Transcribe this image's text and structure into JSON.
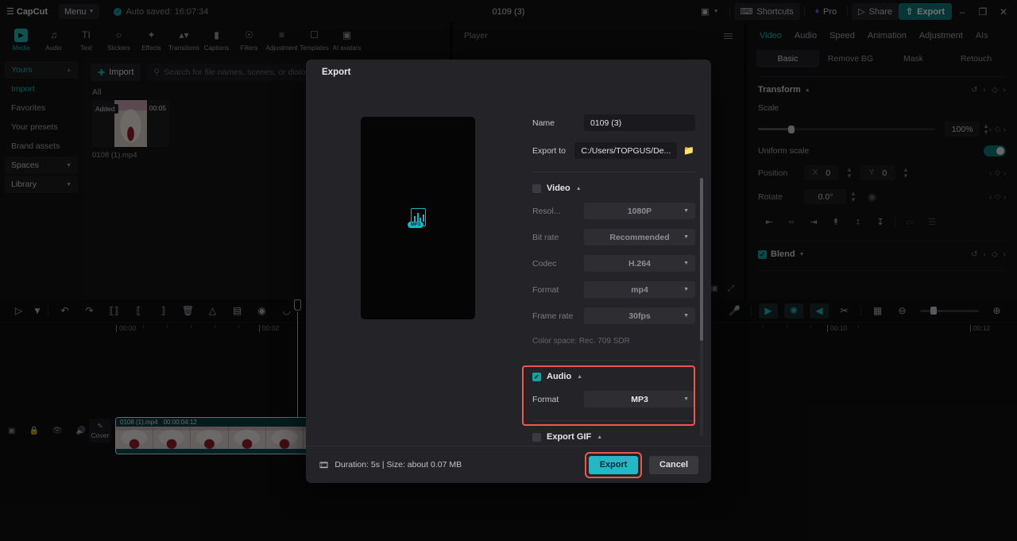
{
  "topbar": {
    "logo_text": "CapCut",
    "menu_label": "Menu",
    "autosave_text": "Auto saved: 16:07:34",
    "project_title": "0109 (3)",
    "layout_icon": "layout-icon",
    "shortcuts_label": "Shortcuts",
    "pro_label": "Pro",
    "share_label": "Share",
    "export_label": "Export",
    "minimize_label": "–",
    "maximize_label": "❐",
    "close_label": "✕"
  },
  "tooltabs": [
    {
      "label": "Media",
      "icon": "media-icon",
      "active": true
    },
    {
      "label": "Audio",
      "icon": "audio-icon",
      "active": false
    },
    {
      "label": "Text",
      "icon": "text-icon",
      "active": false
    },
    {
      "label": "Stickers",
      "icon": "stickers-icon",
      "active": false
    },
    {
      "label": "Effects",
      "icon": "effects-icon",
      "active": false
    },
    {
      "label": "Transitions",
      "icon": "transitions-icon",
      "active": false
    },
    {
      "label": "Captions",
      "icon": "captions-icon",
      "active": false
    },
    {
      "label": "Filters",
      "icon": "filters-icon",
      "active": false
    },
    {
      "label": "Adjustment",
      "icon": "adjustment-icon",
      "active": false
    },
    {
      "label": "Templates",
      "icon": "templates-icon",
      "active": false
    },
    {
      "label": "AI avatars",
      "icon": "ai-avatars-icon",
      "active": false
    }
  ],
  "sidebar": {
    "items": [
      {
        "label": "Yours",
        "type": "group",
        "expanded": true
      },
      {
        "label": "Import",
        "type": "item",
        "selected": true
      },
      {
        "label": "Favorites",
        "type": "item",
        "selected": false
      },
      {
        "label": "Your presets",
        "type": "item",
        "selected": false
      },
      {
        "label": "Brand assets",
        "type": "item",
        "selected": false
      },
      {
        "label": "Spaces",
        "type": "group",
        "expanded": false
      },
      {
        "label": "Library",
        "type": "group",
        "expanded": false
      }
    ]
  },
  "media": {
    "import_label": "Import",
    "search_placeholder": "Search for file names, scenes, or dialogs",
    "filter_label": "All",
    "item": {
      "badge": "Added",
      "duration": "00:05",
      "name": "0108 (1).mp4"
    }
  },
  "player": {
    "title": "Player"
  },
  "rightpanel": {
    "tabs": [
      {
        "label": "Video",
        "active": true
      },
      {
        "label": "Audio",
        "active": false
      },
      {
        "label": "Speed",
        "active": false
      },
      {
        "label": "Animation",
        "active": false
      },
      {
        "label": "Adjustment",
        "active": false
      },
      {
        "label": "AIs",
        "active": false
      }
    ],
    "subtabs": [
      {
        "label": "Basic",
        "active": true
      },
      {
        "label": "Remove BG",
        "active": false
      },
      {
        "label": "Mask",
        "active": false
      },
      {
        "label": "Retouch",
        "active": false
      }
    ],
    "transform": {
      "title": "Transform",
      "scale_label": "Scale",
      "scale_value": "100%",
      "uniform_label": "Uniform scale",
      "uniform_on": true,
      "position_label": "Position",
      "position_x_axis": "X",
      "position_x": "0",
      "position_y_axis": "Y",
      "position_y": "0",
      "rotate_label": "Rotate",
      "rotate_value": "0.0°"
    },
    "blend": {
      "title": "Blend",
      "checked": true
    }
  },
  "timeline": {
    "ruler_left": [
      "00:00",
      "00:02"
    ],
    "ruler_right": [
      "00:10",
      "00:12"
    ],
    "cover_label": "Cover",
    "clip": {
      "name": "0108 (1).mp4",
      "duration": "00:00:04:12"
    }
  },
  "dialog": {
    "title": "Export",
    "name_label": "Name",
    "name_value": "0109 (3)",
    "export_to_label": "Export to",
    "export_to_value": "C:/Users/TOPGUS/De...",
    "folder_icon": "folder-icon",
    "video": {
      "title": "Video",
      "checked": false,
      "fields": [
        {
          "label": "Resol...",
          "value": "1080P"
        },
        {
          "label": "Bit rate",
          "value": "Recommended"
        },
        {
          "label": "Codec",
          "value": "H.264"
        },
        {
          "label": "Format",
          "value": "mp4"
        },
        {
          "label": "Frame rate",
          "value": "30fps"
        }
      ],
      "color_space": "Color space: Rec. 709 SDR"
    },
    "audio": {
      "title": "Audio",
      "checked": true,
      "format_label": "Format",
      "format_value": "MP3",
      "highlight_color": "#f0564a"
    },
    "gif": {
      "title": "Export GIF",
      "checked": false
    },
    "footer": {
      "info": "Duration: 5s | Size: about 0.07 MB",
      "export_label": "Export",
      "cancel_label": "Cancel",
      "export_color": "#22b8c6"
    },
    "preview_icon": "mp3-file-icon"
  }
}
